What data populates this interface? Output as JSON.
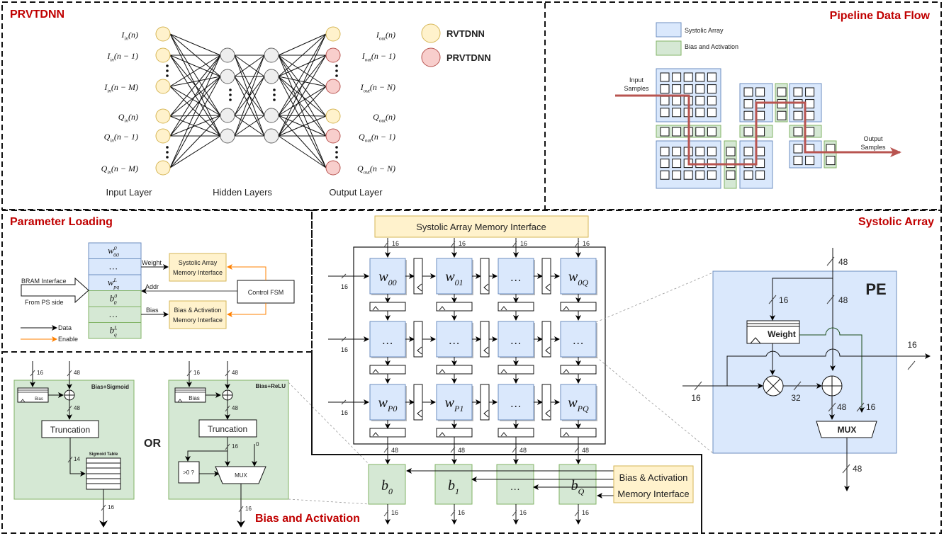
{
  "colors": {
    "title_red": "#c00000",
    "systolic_blue": "#dae8fc",
    "systolic_blue_stroke": "#6c8ebf",
    "bias_green": "#d5e8d4",
    "bias_green_stroke": "#82b366",
    "iface_yellow": "#fff2cc",
    "iface_yellow_stroke": "#d6b656",
    "rv_node_fill": "#fff2cc",
    "rv_node_stroke": "#d6b656",
    "prv_node_fill": "#f8cecc",
    "prv_node_stroke": "#b85450",
    "hidden_node_fill": "#eeeeee",
    "hidden_node_stroke": "#666666",
    "flow_red": "#b85450",
    "enable_orange": "#ff8000"
  },
  "prvtdnn": {
    "title": "PRVTDNN",
    "input_labels": [
      "I_in(n)",
      "I_in(n − 1)",
      "I_in(n − M)",
      "Q_in(n)",
      "Q_in(n − 1)",
      "Q_in(n − M)"
    ],
    "input_label_parts": [
      {
        "base": "I",
        "sub": "in",
        "arg": "(n)"
      },
      {
        "base": "I",
        "sub": "in",
        "arg": "(n − 1)"
      },
      {
        "base": "I",
        "sub": "in",
        "arg": "(n − M)"
      },
      {
        "base": "Q",
        "sub": "in",
        "arg": "(n)"
      },
      {
        "base": "Q",
        "sub": "in",
        "arg": "(n − 1)"
      },
      {
        "base": "Q",
        "sub": "in",
        "arg": "(n − M)"
      }
    ],
    "output_label_parts": [
      {
        "base": "I",
        "sub": "out",
        "arg": "(n)"
      },
      {
        "base": "I",
        "sub": "out",
        "arg": "(n − 1)"
      },
      {
        "base": "I",
        "sub": "out",
        "arg": "(n − N)"
      },
      {
        "base": "Q",
        "sub": "out",
        "arg": "(n)"
      },
      {
        "base": "Q",
        "sub": "out",
        "arg": "(n − 1)"
      },
      {
        "base": "Q",
        "sub": "out",
        "arg": "(n − N)"
      }
    ],
    "output_node_types": [
      "rv",
      "prv",
      "prv",
      "rv",
      "prv",
      "prv"
    ],
    "layer_labels": {
      "input": "Input Layer",
      "hidden": "Hidden Layers",
      "output": "Output Layer"
    },
    "legend": [
      {
        "type": "rv",
        "label": "RVTDNN"
      },
      {
        "type": "prv",
        "label": "PRVTDNN"
      }
    ]
  },
  "pipeline": {
    "title": "Pipeline Data Flow",
    "legend": [
      {
        "type": "systolic",
        "label": "Systolic Array"
      },
      {
        "type": "bias",
        "label": "Bias and Activation"
      }
    ],
    "input_label": [
      "Input",
      "Samples"
    ],
    "output_label": [
      "Output",
      "Samples"
    ]
  },
  "param_loading": {
    "title": "Parameter Loading",
    "memory_rows": [
      {
        "base": "w",
        "sub": "00",
        "sup": "0",
        "kind": "weight"
      },
      {
        "base": "…",
        "sub": "",
        "sup": "",
        "kind": "weight"
      },
      {
        "base": "w",
        "sub": "pq",
        "sup": "L",
        "kind": "weight"
      },
      {
        "base": "b",
        "sub": "0",
        "sup": "0",
        "kind": "bias"
      },
      {
        "base": "…",
        "sub": "",
        "sup": "",
        "kind": "bias"
      },
      {
        "base": "b",
        "sub": "q",
        "sup": "L",
        "kind": "bias"
      }
    ],
    "bram_label_top": "BRAM Interface",
    "bram_label_bottom": "From PS side",
    "weight_label": "Weight",
    "addr_label": "Addr",
    "bias_label": "Bias",
    "systolic_iface": [
      "Systolic Array",
      "Memory Interface"
    ],
    "bias_iface": [
      "Bias & Activation",
      "Memory Interface"
    ],
    "control_fsm": "Control FSM",
    "legend_data": "Data",
    "legend_enable": "Enable"
  },
  "bias_activation": {
    "title": "Bias and Activation",
    "or_label": "OR",
    "sigmoid_block": {
      "title": "Bias+Sigmoid",
      "bias_reg": "Bias",
      "truncation": "Truncation",
      "table": "Sigmoid Table",
      "widths": {
        "bias_in": "16",
        "acc_in": "48",
        "sum_out": "48",
        "trunc_out": "14",
        "out": "16"
      }
    },
    "relu_block": {
      "title": "Bias+ReLU",
      "bias_reg": "Bias",
      "truncation": "Truncation",
      "compare": ">0 ?",
      "mux": "MUX",
      "zero": "0",
      "widths": {
        "bias_in": "16",
        "acc_in": "48",
        "sum_out": "48",
        "trunc_out": "16",
        "out": "16"
      }
    },
    "bias_units": [
      {
        "base": "b",
        "sub": "0"
      },
      {
        "base": "b",
        "sub": "1"
      },
      {
        "base": "…",
        "sub": ""
      },
      {
        "base": "b",
        "sub": "Q"
      }
    ],
    "memory_iface": [
      "Bias & Activation",
      "Memory Interface"
    ],
    "in_width": "48",
    "out_width": "16"
  },
  "systolic": {
    "title": "Systolic Array",
    "memory_iface": "Systolic Array Memory Interface",
    "col_in_widths": [
      "16",
      "16",
      "16",
      "16"
    ],
    "row_in_widths": [
      "16",
      "16",
      "16"
    ],
    "out_widths": [
      "48",
      "48",
      "48",
      "48"
    ],
    "cells": [
      [
        {
          "base": "w",
          "sub": "00"
        },
        {
          "base": "w",
          "sub": "01"
        },
        {
          "base": "…",
          "sub": ""
        },
        {
          "base": "w",
          "sub": "0Q"
        }
      ],
      [
        {
          "base": "…",
          "sub": ""
        },
        {
          "base": "…",
          "sub": ""
        },
        {
          "base": "…",
          "sub": ""
        },
        {
          "base": "…",
          "sub": ""
        }
      ],
      [
        {
          "base": "w",
          "sub": "P0"
        },
        {
          "base": "w",
          "sub": "P1"
        },
        {
          "base": "…",
          "sub": ""
        },
        {
          "base": "w",
          "sub": "PQ"
        }
      ]
    ],
    "pe": {
      "title": "PE",
      "weight_reg": "Weight",
      "mux": "MUX",
      "widths": {
        "acc_in": "48",
        "weight_in": "16",
        "acc_inner": "48",
        "data_in": "16",
        "product": "32",
        "sum": "48",
        "weight_out": "16",
        "data_out": "16",
        "out": "48"
      }
    }
  }
}
